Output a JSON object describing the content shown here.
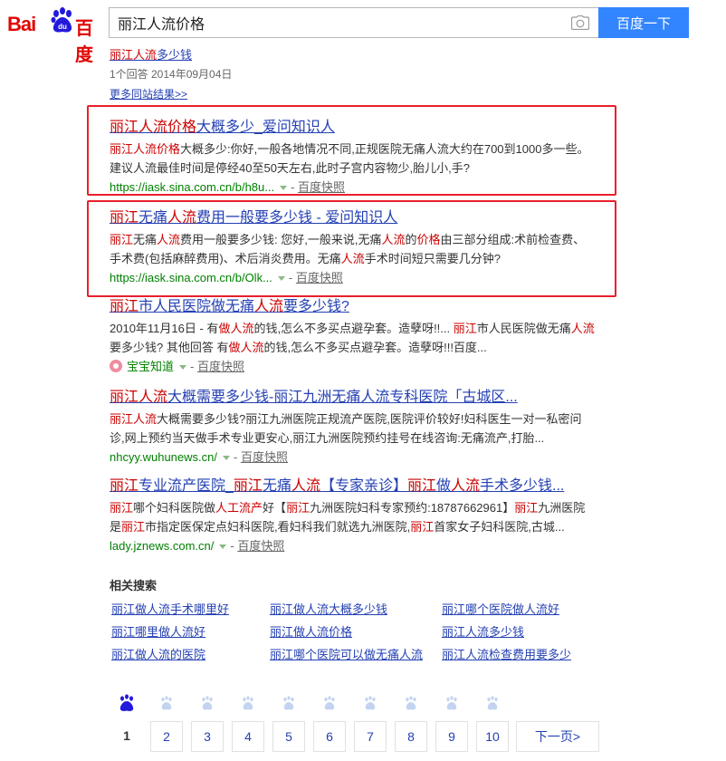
{
  "header": {
    "logo_bai": "Bai",
    "logo_du": "du",
    "logo_cn": "百度",
    "query": "丽江人流价格",
    "search_button": "百度一下",
    "icon_camera": "camera-icon"
  },
  "top_snippet": {
    "title_hl": "丽江人流",
    "title_rest": "多少钱",
    "meta": "1个回答  2014年09月04日",
    "more": "更多同站结果>>"
  },
  "results": [
    {
      "title_hl": "丽江人流价格",
      "title_rest": "大概多少_爱问知识人",
      "abs_hl1": "丽江人流价格",
      "abs_rest1": "大概多少:你好,一般各地情况不同,正规医院无痛人流大约在700到1000多一些。",
      "abs_line2": "建议人流最佳时间是停经40至50天左右,此时子宫内容物少,胎儿小,手?",
      "url": "https://iask.sina.com.cn/b/h8u...",
      "cache": "百度快照"
    },
    {
      "t_hl1": "丽江",
      "t_p1": "无痛",
      "t_hl2": "人流",
      "t_p2": "费用一般要多少钱 - 爱问知识人",
      "a_hl1": "丽江",
      "a_p1": "无痛",
      "a_hl2": "人流",
      "a_p2": "费用一般要多少钱: 您好,一般来说,无痛",
      "a_hl3": "人流",
      "a_p3": "的",
      "a_hl4": "价格",
      "a_p4": "由三部分组成:术前检查费、",
      "a_line2a": "手术费(包括麻醉费用)、术后消炎费用。无痛",
      "a_hl5": "人流",
      "a_line2b": "手术时间短只需要几分钟?",
      "url": "https://iask.sina.com.cn/b/Olk...",
      "cache": "百度快照"
    },
    {
      "t_hl1": "丽江",
      "t_p1": "市人民医院做无痛",
      "t_hl2": "人流",
      "t_p2": "要多少钱?",
      "a_p1": "2010年11月16日 - 有",
      "a_hl1": "做人流",
      "a_p2": "的钱,怎么不多买点避孕套。造孽呀!!... ",
      "a_hl2": "丽江",
      "a_p3": "市人民医院做无痛",
      "a_hl3": "人流",
      "a_line2a": "要多少钱? 其他回答 有",
      "a_hl4": "做人流",
      "a_line2b": "的钱,怎么不多买点避孕套。造孽呀!!!百度...",
      "source": "宝宝知道",
      "cache": "百度快照"
    },
    {
      "t_hl1": "丽江人流",
      "t_p1": "大概需要多少钱-丽江九洲无痛人流专科医院「古城区...",
      "a_hl1": "丽江人流",
      "a_p1": "大概需要多少钱?丽江九洲医院正规流产医院,医院评价较好!妇科医生一对一私密问",
      "a_line2": "诊,网上预约当天做手术专业更安心,丽江九洲医院预约挂号在线咨询:无痛流产,打胎...",
      "url": "nhcyy.wuhunews.cn/",
      "cache": "百度快照"
    },
    {
      "t_hl1": "丽江",
      "t_p1": "专业流产医院_",
      "t_hl2": "丽江",
      "t_p2": "无痛",
      "t_hl3": "人流",
      "t_p3": "【专家亲诊】",
      "t_hl4": "丽江",
      "t_p4": "做",
      "t_hl5": "人流",
      "t_p5": "手术多少钱...",
      "a_hl1": "丽江",
      "a_p1": "哪个妇科医院做",
      "a_hl2": "人工流产",
      "a_p2": "好【",
      "a_hl3": "丽江",
      "a_p3": "九洲医院妇科专家预约:18787662961】",
      "a_hl4": "丽江",
      "a_p4": "九洲医院",
      "a_line2a": "是",
      "a_hl5": "丽江",
      "a_line2b": "市指定医保定点妇科医院,看妇科我们就选九洲医院,",
      "a_hl6": "丽江",
      "a_line2c": "首家女子妇科医院,古城...",
      "url": "lady.jznews.com.cn/",
      "cache": "百度快照"
    }
  ],
  "related": {
    "title": "相关搜索",
    "links": [
      "丽江做人流手术哪里好",
      "丽江做人流大概多少钱",
      "丽江哪个医院做人流好",
      "丽江哪里做人流好",
      "丽江做人流价格",
      "丽江人流多少钱",
      "丽江做人流的医院",
      "丽江哪个医院可以做无痛人流",
      "丽江人流检查费用要多少"
    ]
  },
  "pagination": {
    "pages": [
      "1",
      "2",
      "3",
      "4",
      "5",
      "6",
      "7",
      "8",
      "9",
      "10"
    ],
    "current": "1",
    "next": "下一页>",
    "icon_paw": "paw-icon"
  },
  "colors": {
    "link": "#2440b3",
    "highlight": "#c00",
    "url": "#008000",
    "brand_red": "#e10602",
    "button_blue": "#3385ff",
    "annotation_box": "#e8202c"
  }
}
